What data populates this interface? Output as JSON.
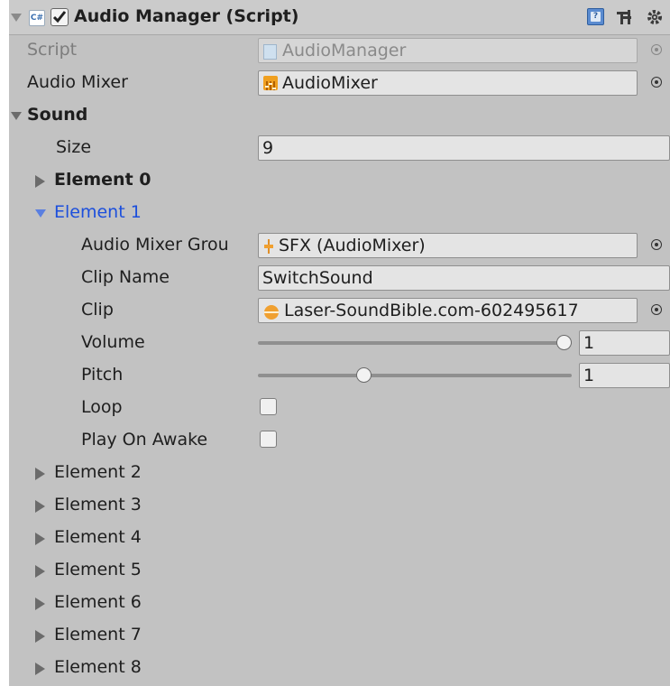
{
  "header": {
    "enabled": true,
    "title": "Audio Manager (Script)",
    "script_icon": "C#"
  },
  "script_field": {
    "label": "Script",
    "value": "AudioManager"
  },
  "mixer_field": {
    "label": "Audio Mixer",
    "value": "AudioMixer"
  },
  "sound": {
    "label": "Sound",
    "size_label": "Size",
    "size_value": "9",
    "element0": "Element 0",
    "element1": {
      "label": "Element 1",
      "group_label": "Audio Mixer Grou",
      "group_value": "SFX (AudioMixer)",
      "clipname_label": "Clip Name",
      "clipname_value": "SwitchSound",
      "clip_label": "Clip",
      "clip_value": "Laser-SoundBible.com-602495617",
      "volume_label": "Volume",
      "volume_value": "1",
      "volume_level": 1.0,
      "pitch_label": "Pitch",
      "pitch_value": "1",
      "pitch_level": 0.33,
      "loop_label": "Loop",
      "loop_checked": false,
      "awake_label": "Play On Awake",
      "awake_checked": false
    },
    "rest": [
      "Element 2",
      "Element 3",
      "Element 4",
      "Element 5",
      "Element 6",
      "Element 7",
      "Element 8"
    ]
  }
}
